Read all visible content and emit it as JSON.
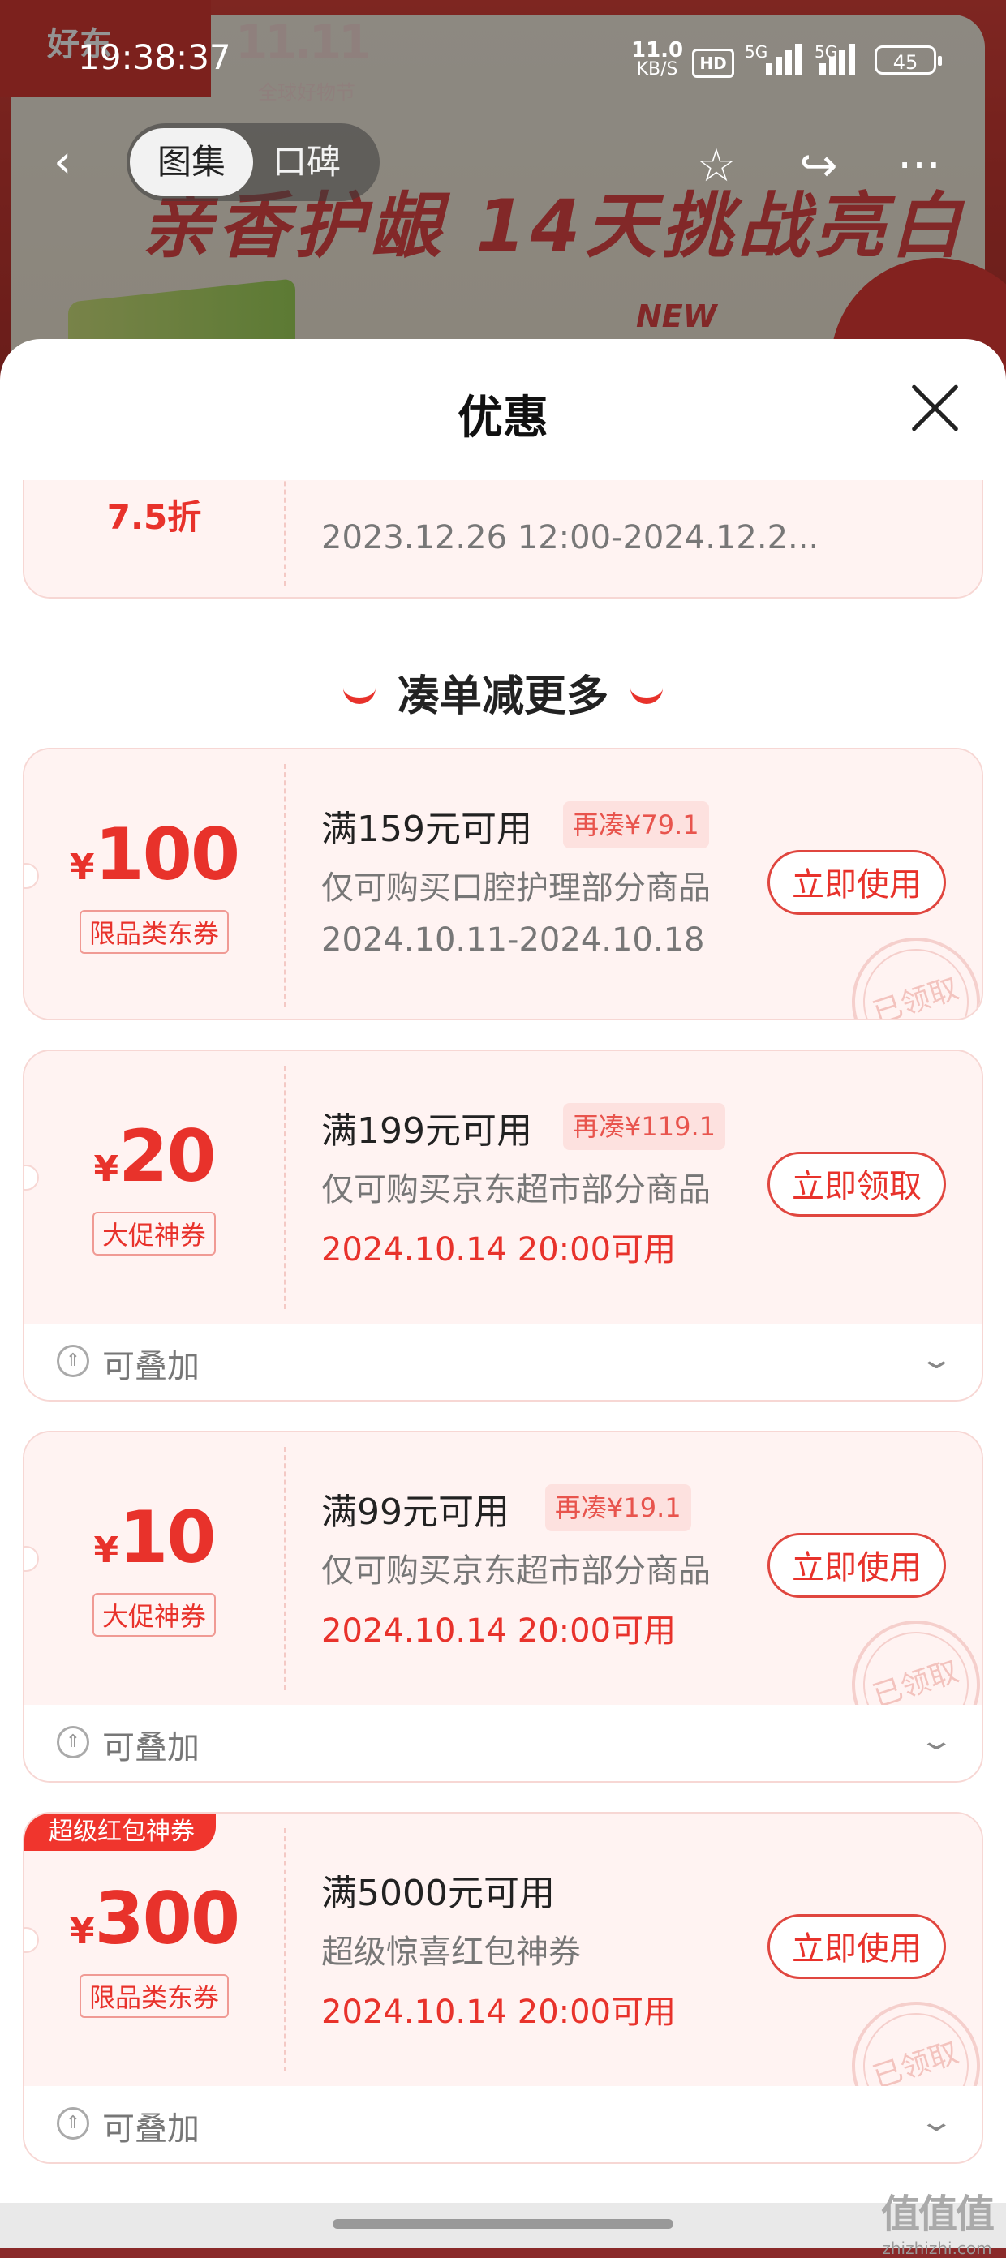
{
  "status_bar": {
    "time": "19:38:37",
    "net_speed": "11.0",
    "net_unit": "KB/S",
    "hd": "HD",
    "sig1": "5G",
    "sig2": "5G",
    "battery": "45"
  },
  "background": {
    "logo_text": "好东",
    "festival": "11.11",
    "festival_sub": "全球好物节",
    "slogan": "亲香护龈 14天挑战亮白",
    "new_badge": "NEW"
  },
  "nav": {
    "tab_gallery": "图集",
    "tab_reviews": "口碑"
  },
  "sheet": {
    "title": "优惠",
    "partial_card": {
      "amount": "7.5折",
      "date": "2023.12.26 12:00-2024.12.2..."
    },
    "section_title": "凑单减更多",
    "stack_label": "可叠加",
    "coupons": [
      {
        "yen": "¥",
        "amount": "100",
        "type": "限品类东券",
        "min": "满159元可用",
        "extra": "再凑¥79.1",
        "scope": "仅可购买口腔护理部分商品",
        "date": "2024.10.11-2024.10.18",
        "button": "立即使用",
        "stamp": "已领取"
      },
      {
        "yen": "¥",
        "amount": "20",
        "type": "大促神券",
        "min": "满199元可用",
        "extra": "再凑¥119.1",
        "scope": "仅可购买京东超市部分商品",
        "date": "2024.10.14 20:00可用",
        "button": "立即领取"
      },
      {
        "yen": "¥",
        "amount": "10",
        "type": "大促神券",
        "min": "满99元可用",
        "extra": "再凑¥19.1",
        "scope": "仅可购买京东超市部分商品",
        "date": "2024.10.14 20:00可用",
        "button": "立即使用",
        "stamp": "已领取"
      },
      {
        "badge": "超级红包神券",
        "yen": "¥",
        "amount": "300",
        "type": "限品类东券",
        "min": "满5000元可用",
        "scope": "超级惊喜红包神券",
        "date": "2024.10.14 20:00可用",
        "button": "立即使用",
        "stamp": "已领取"
      }
    ]
  },
  "watermark": {
    "logo": "值值值",
    "site": "zhizhizhi.com"
  },
  "colors": {
    "accent": "#e8322b",
    "card_bg": "#fff3f2",
    "card_border": "#f7d7d4"
  }
}
